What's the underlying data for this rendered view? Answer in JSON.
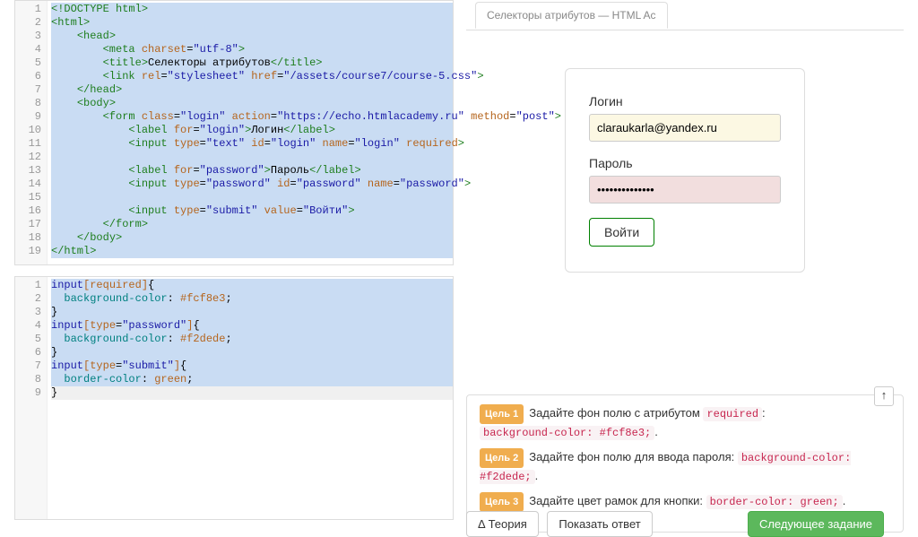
{
  "editors": {
    "html": {
      "badge": "HTML",
      "lines": [
        [
          {
            "c": "t-tag",
            "t": "<!DOCTYPE html>"
          }
        ],
        [
          {
            "c": "t-tag",
            "t": "<html>"
          }
        ],
        [
          {
            "c": "",
            "t": "    "
          },
          {
            "c": "t-tag",
            "t": "<head>"
          }
        ],
        [
          {
            "c": "",
            "t": "        "
          },
          {
            "c": "t-tag",
            "t": "<meta"
          },
          {
            "c": "",
            "t": " "
          },
          {
            "c": "t-attr",
            "t": "charset"
          },
          {
            "c": "t-text",
            "t": "="
          },
          {
            "c": "t-str",
            "t": "\"utf-8\""
          },
          {
            "c": "t-tag",
            "t": ">"
          }
        ],
        [
          {
            "c": "",
            "t": "        "
          },
          {
            "c": "t-tag",
            "t": "<title>"
          },
          {
            "c": "t-text",
            "t": "Селекторы атрибутов"
          },
          {
            "c": "t-tag",
            "t": "</title>"
          }
        ],
        [
          {
            "c": "",
            "t": "        "
          },
          {
            "c": "t-tag",
            "t": "<link"
          },
          {
            "c": "",
            "t": " "
          },
          {
            "c": "t-attr",
            "t": "rel"
          },
          {
            "c": "t-text",
            "t": "="
          },
          {
            "c": "t-str",
            "t": "\"stylesheet\""
          },
          {
            "c": "",
            "t": " "
          },
          {
            "c": "t-attr",
            "t": "href"
          },
          {
            "c": "t-text",
            "t": "="
          },
          {
            "c": "t-str",
            "t": "\"/assets/course7/course-5.css\""
          },
          {
            "c": "t-tag",
            "t": ">"
          }
        ],
        [
          {
            "c": "",
            "t": "    "
          },
          {
            "c": "t-tag",
            "t": "</head>"
          }
        ],
        [
          {
            "c": "",
            "t": "    "
          },
          {
            "c": "t-tag",
            "t": "<body>"
          }
        ],
        [
          {
            "c": "",
            "t": "        "
          },
          {
            "c": "t-tag",
            "t": "<form"
          },
          {
            "c": "",
            "t": " "
          },
          {
            "c": "t-attr",
            "t": "class"
          },
          {
            "c": "t-text",
            "t": "="
          },
          {
            "c": "t-str",
            "t": "\"login\""
          },
          {
            "c": "",
            "t": " "
          },
          {
            "c": "t-attr",
            "t": "action"
          },
          {
            "c": "t-text",
            "t": "="
          },
          {
            "c": "t-str",
            "t": "\"https://echo.htmlacademy.ru\""
          },
          {
            "c": "",
            "t": " "
          },
          {
            "c": "t-attr",
            "t": "method"
          },
          {
            "c": "t-text",
            "t": "="
          },
          {
            "c": "t-str",
            "t": "\"post\""
          },
          {
            "c": "t-tag",
            "t": ">"
          }
        ],
        [
          {
            "c": "",
            "t": "            "
          },
          {
            "c": "t-tag",
            "t": "<label"
          },
          {
            "c": "",
            "t": " "
          },
          {
            "c": "t-attr",
            "t": "for"
          },
          {
            "c": "t-text",
            "t": "="
          },
          {
            "c": "t-str",
            "t": "\"login\""
          },
          {
            "c": "t-tag",
            "t": ">"
          },
          {
            "c": "t-text",
            "t": "Логин"
          },
          {
            "c": "t-tag",
            "t": "</label>"
          }
        ],
        [
          {
            "c": "",
            "t": "            "
          },
          {
            "c": "t-tag",
            "t": "<input"
          },
          {
            "c": "",
            "t": " "
          },
          {
            "c": "t-attr",
            "t": "type"
          },
          {
            "c": "t-text",
            "t": "="
          },
          {
            "c": "t-str",
            "t": "\"text\""
          },
          {
            "c": "",
            "t": " "
          },
          {
            "c": "t-attr",
            "t": "id"
          },
          {
            "c": "t-text",
            "t": "="
          },
          {
            "c": "t-str",
            "t": "\"login\""
          },
          {
            "c": "",
            "t": " "
          },
          {
            "c": "t-attr",
            "t": "name"
          },
          {
            "c": "t-text",
            "t": "="
          },
          {
            "c": "t-str",
            "t": "\"login\""
          },
          {
            "c": "",
            "t": " "
          },
          {
            "c": "t-attr",
            "t": "required"
          },
          {
            "c": "t-tag",
            "t": ">"
          }
        ],
        [
          {
            "c": "",
            "t": ""
          }
        ],
        [
          {
            "c": "",
            "t": "            "
          },
          {
            "c": "t-tag",
            "t": "<label"
          },
          {
            "c": "",
            "t": " "
          },
          {
            "c": "t-attr",
            "t": "for"
          },
          {
            "c": "t-text",
            "t": "="
          },
          {
            "c": "t-str",
            "t": "\"password\""
          },
          {
            "c": "t-tag",
            "t": ">"
          },
          {
            "c": "t-text",
            "t": "Пароль"
          },
          {
            "c": "t-tag",
            "t": "</label>"
          }
        ],
        [
          {
            "c": "",
            "t": "            "
          },
          {
            "c": "t-tag",
            "t": "<input"
          },
          {
            "c": "",
            "t": " "
          },
          {
            "c": "t-attr",
            "t": "type"
          },
          {
            "c": "t-text",
            "t": "="
          },
          {
            "c": "t-str",
            "t": "\"password\""
          },
          {
            "c": "",
            "t": " "
          },
          {
            "c": "t-attr",
            "t": "id"
          },
          {
            "c": "t-text",
            "t": "="
          },
          {
            "c": "t-str",
            "t": "\"password\""
          },
          {
            "c": "",
            "t": " "
          },
          {
            "c": "t-attr",
            "t": "name"
          },
          {
            "c": "t-text",
            "t": "="
          },
          {
            "c": "t-str",
            "t": "\"password\""
          },
          {
            "c": "t-tag",
            "t": ">"
          }
        ],
        [
          {
            "c": "",
            "t": ""
          }
        ],
        [
          {
            "c": "",
            "t": "            "
          },
          {
            "c": "t-tag",
            "t": "<input"
          },
          {
            "c": "",
            "t": " "
          },
          {
            "c": "t-attr",
            "t": "type"
          },
          {
            "c": "t-text",
            "t": "="
          },
          {
            "c": "t-str",
            "t": "\"submit\""
          },
          {
            "c": "",
            "t": " "
          },
          {
            "c": "t-attr",
            "t": "value"
          },
          {
            "c": "t-text",
            "t": "="
          },
          {
            "c": "t-str",
            "t": "\"Войти\""
          },
          {
            "c": "t-tag",
            "t": ">"
          }
        ],
        [
          {
            "c": "",
            "t": "        "
          },
          {
            "c": "t-tag",
            "t": "</form>"
          }
        ],
        [
          {
            "c": "",
            "t": "    "
          },
          {
            "c": "t-tag",
            "t": "</body>"
          }
        ],
        [
          {
            "c": "t-tag",
            "t": "</html>"
          }
        ]
      ]
    },
    "css": {
      "badge": "CSS",
      "lines": [
        [
          {
            "c": "t-sel",
            "t": "input"
          },
          {
            "c": "t-bracket",
            "t": "["
          },
          {
            "c": "t-attr",
            "t": "required"
          },
          {
            "c": "t-bracket",
            "t": "]"
          },
          {
            "c": "t-brace",
            "t": "{"
          }
        ],
        [
          {
            "c": "",
            "t": "  "
          },
          {
            "c": "t-prop",
            "t": "background-color"
          },
          {
            "c": "t-text",
            "t": ": "
          },
          {
            "c": "t-val",
            "t": "#fcf8e3"
          },
          {
            "c": "t-text",
            "t": ";"
          }
        ],
        [
          {
            "c": "t-brace",
            "t": "}"
          }
        ],
        [
          {
            "c": "t-sel",
            "t": "input"
          },
          {
            "c": "t-bracket",
            "t": "["
          },
          {
            "c": "t-attr",
            "t": "type"
          },
          {
            "c": "t-text",
            "t": "="
          },
          {
            "c": "t-str",
            "t": "\"password\""
          },
          {
            "c": "t-bracket",
            "t": "]"
          },
          {
            "c": "t-brace",
            "t": "{"
          }
        ],
        [
          {
            "c": "",
            "t": "  "
          },
          {
            "c": "t-prop",
            "t": "background-color"
          },
          {
            "c": "t-text",
            "t": ": "
          },
          {
            "c": "t-val",
            "t": "#f2dede"
          },
          {
            "c": "t-text",
            "t": ";"
          }
        ],
        [
          {
            "c": "t-brace",
            "t": "}"
          }
        ],
        [
          {
            "c": "t-sel",
            "t": "input"
          },
          {
            "c": "t-bracket",
            "t": "["
          },
          {
            "c": "t-attr",
            "t": "type"
          },
          {
            "c": "t-text",
            "t": "="
          },
          {
            "c": "t-str",
            "t": "\"submit\""
          },
          {
            "c": "t-bracket",
            "t": "]"
          },
          {
            "c": "t-brace",
            "t": "{"
          }
        ],
        [
          {
            "c": "",
            "t": "  "
          },
          {
            "c": "t-prop",
            "t": "border-color"
          },
          {
            "c": "t-text",
            "t": ": "
          },
          {
            "c": "t-val",
            "t": "green"
          },
          {
            "c": "t-text",
            "t": ";"
          }
        ],
        [
          {
            "c": "t-brace",
            "t": "}"
          }
        ]
      ]
    }
  },
  "preview": {
    "tab_label": "Селекторы атрибутов — HTML Ac",
    "login_label": "Логин",
    "login_value": "claraukarla@yandex.ru",
    "password_label": "Пароль",
    "password_value": "••••••••••••••",
    "submit_label": "Войти"
  },
  "goals": {
    "scroll_top_icon": "↑",
    "items": [
      {
        "badge": "Цель 1",
        "text_before": "Задайте фон полю с атрибутом ",
        "code1": "required",
        "text_mid": ": ",
        "code2": "background-color: #fcf8e3;",
        "text_after": "."
      },
      {
        "badge": "Цель 2",
        "text_before": "Задайте фон полю для ввода пароля: ",
        "code1": "background-color: #f2dede;",
        "text_mid": "",
        "code2": "",
        "text_after": "."
      },
      {
        "badge": "Цель 3",
        "text_before": "Задайте цвет рамок для кнопки: ",
        "code1": "border-color: green;",
        "text_mid": "",
        "code2": "",
        "text_after": "."
      }
    ]
  },
  "buttons": {
    "theory": "Δ Теория",
    "show_answer": "Показать ответ",
    "next": "Следующее задание"
  }
}
